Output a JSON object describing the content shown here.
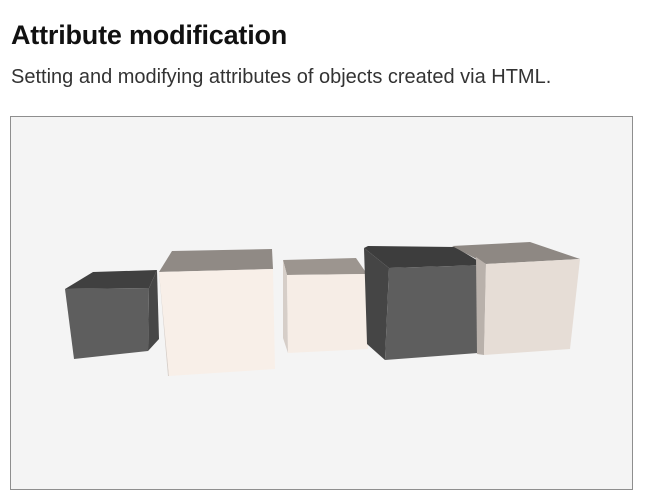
{
  "header": {
    "title": "Attribute modification",
    "subtitle": "Setting and modifying attributes of objects created via HTML."
  },
  "scene": {
    "background_color": "#f4f4f4",
    "border_color": "#8e8e8e",
    "boxes": [
      {
        "id": "box-1",
        "color": "gray",
        "front": "#5e5e5e",
        "top": "#404040",
        "side": "#474747",
        "label": ""
      },
      {
        "id": "box-2",
        "color": "cream",
        "front": "#f8efe8",
        "top": "#908a85",
        "side": "#d6cec8",
        "label": ""
      },
      {
        "id": "box-3",
        "color": "cream",
        "front": "#f6ede6",
        "top": "#9c958f",
        "side": "#d6cec8",
        "label": ""
      },
      {
        "id": "box-4",
        "color": "gray",
        "front": "#5e5e5e",
        "top": "#3d3d3d",
        "side": "#454545",
        "label": ""
      },
      {
        "id": "box-5",
        "color": "cream",
        "front": "#e6ddd6",
        "top": "#8e8883",
        "side": "#b9b1ab",
        "label": ""
      }
    ]
  }
}
